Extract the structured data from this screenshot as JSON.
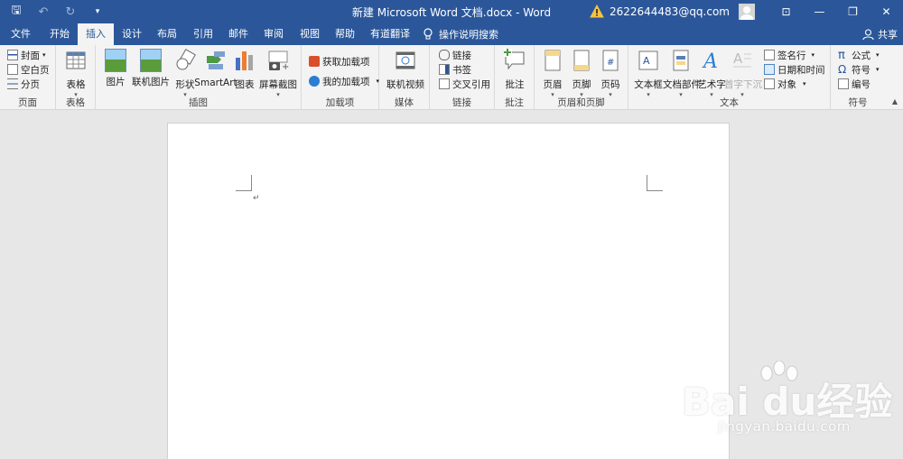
{
  "titlebar": {
    "title": "新建 Microsoft Word 文档.docx  -  Word",
    "account": "2622644483@qq.com",
    "icons": [
      "save-icon",
      "undo-icon",
      "redo-icon",
      "customize-qat-icon",
      "warning-icon",
      "ribbon-display-icon",
      "minimize-icon",
      "restore-icon",
      "close-icon"
    ],
    "glyphs": {
      "save": "🖫",
      "undo": "↶",
      "redo": "↻",
      "customize": "▾",
      "ribbon": "⊡",
      "minimize": "—",
      "restore": "❐",
      "close": "✕"
    }
  },
  "tabs": [
    "文件",
    "开始",
    "插入",
    "设计",
    "布局",
    "引用",
    "邮件",
    "审阅",
    "视图",
    "帮助",
    "有道翻译"
  ],
  "active_tab": "插入",
  "tell_me": "操作说明搜索",
  "share": "共享",
  "ribbon": {
    "pages": {
      "label": "页面",
      "cover": "封面",
      "blank": "空白页",
      "break": "分页"
    },
    "tables": {
      "label": "表格",
      "table": "表格"
    },
    "illustrations": {
      "label": "插图",
      "picture": "图片",
      "online_picture": "联机图片",
      "shapes": "形状",
      "smartart": "SmartArt",
      "chart": "图表",
      "screenshot": "屏幕截图"
    },
    "addins": {
      "label": "加载项",
      "get": "获取加载项",
      "my": "我的加载项"
    },
    "media": {
      "label": "媒体",
      "online_video": "联机视频"
    },
    "links": {
      "label": "链接",
      "link": "链接",
      "bookmark": "书签",
      "cross_ref": "交叉引用"
    },
    "comments": {
      "label": "批注",
      "comment": "批注"
    },
    "header_footer": {
      "label": "页眉和页脚",
      "header": "页眉",
      "footer": "页脚",
      "page_number": "页码"
    },
    "text": {
      "label": "文本",
      "textbox": "文本框",
      "quick_parts": "文档部件",
      "wordart": "艺术字",
      "dropcap": "首字下沉",
      "signature": "签名行",
      "datetime": "日期和时间",
      "object": "对象"
    },
    "symbols": {
      "label": "符号",
      "equation": "公式",
      "symbol": "符号",
      "number": "编号"
    }
  },
  "document": {
    "paragraph_mark": "↵"
  },
  "watermark": {
    "logo": "Bai du经验",
    "url": "jingyan.baidu.com"
  },
  "colors": {
    "accent": "#2b579a",
    "ribbon_bg": "#f3f3f3",
    "canvas_bg": "#e7e7e7"
  }
}
